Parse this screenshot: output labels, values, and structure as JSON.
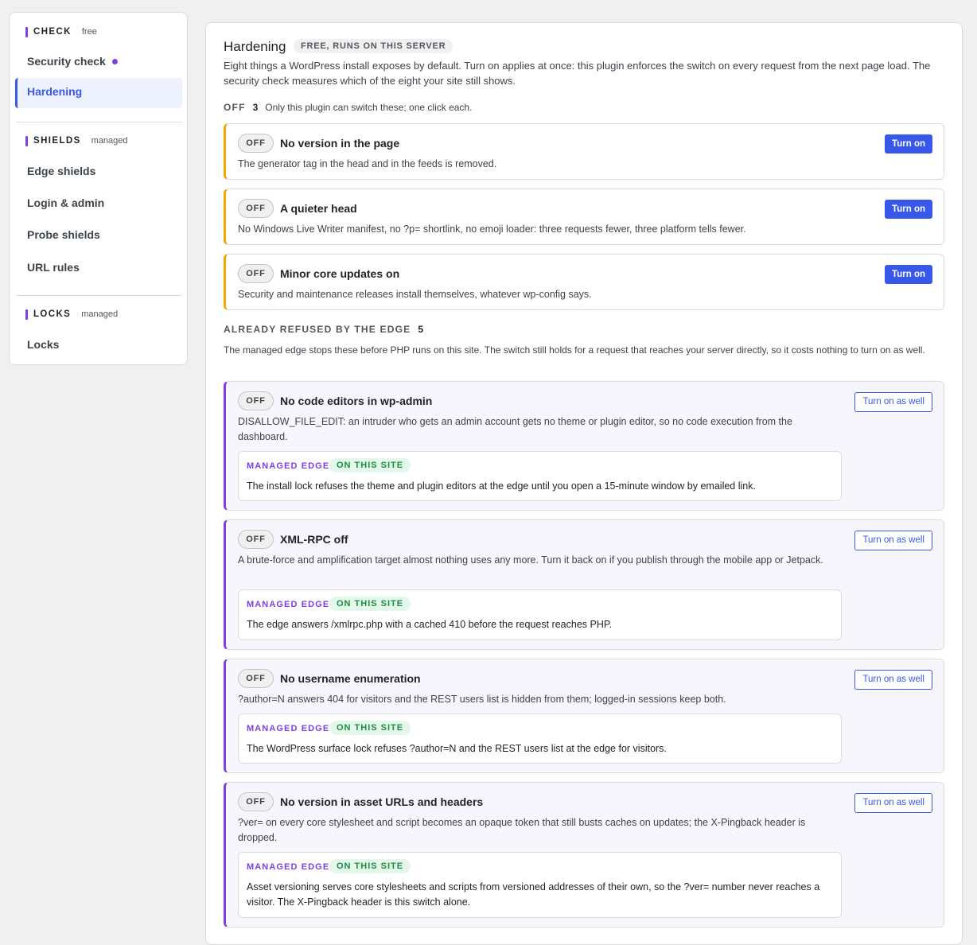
{
  "sidebar": {
    "check": {
      "title": "CHECK",
      "tag": "free",
      "items": [
        "Security check",
        "Hardening"
      ]
    },
    "shields": {
      "title": "SHIELDS",
      "tag": "managed",
      "items": [
        "Edge shields",
        "Login & admin",
        "Probe shields",
        "URL rules"
      ]
    },
    "locks": {
      "title": "LOCKS",
      "tag": "managed",
      "items": [
        "Locks"
      ]
    }
  },
  "main": {
    "title": "Hardening",
    "badge": "FREE, RUNS ON THIS SERVER",
    "intro": "Eight things a WordPress install exposes by default. Turn on applies at once: this plugin enforces the switch on every request from the next page load. The security check measures which of the eight your site still shows.",
    "off_section": {
      "label": "OFF",
      "count": "3",
      "note": "Only this plugin can switch these; one click each."
    },
    "edge_section": {
      "label": "ALREADY REFUSED BY THE EDGE",
      "count": "5",
      "desc": "The managed edge stops these before PHP runs on this site. The switch still holds for a request that reaches your server directly, so it costs nothing to turn on as well."
    },
    "off_label": "OFF",
    "turn_on": "Turn on",
    "turn_on_well": "Turn on as well",
    "managed_edge": "MANAGED EDGE",
    "on_this_site": "ON THIS SITE",
    "off_cards": [
      {
        "title": "No version in the page",
        "desc": "The generator tag in the head and in the feeds is removed."
      },
      {
        "title": "A quieter head",
        "desc": "No Windows Live Writer manifest, no ?p= shortlink, no emoji loader: three requests fewer, three platform tells fewer."
      },
      {
        "title": "Minor core updates on",
        "desc": "Security and maintenance releases install themselves, whatever wp-config says."
      }
    ],
    "edge_cards": [
      {
        "title": "No code editors in wp-admin",
        "desc": "DISALLOW_FILE_EDIT: an intruder who gets an admin account gets no theme or plugin editor, so no code execution from the dashboard.",
        "edge_text": "The install lock refuses the theme and plugin editors at the edge until you open a 15-minute window by emailed link."
      },
      {
        "title": "XML-RPC off",
        "desc": "A brute-force and amplification target almost nothing uses any more. Turn it back on if you publish through the mobile app or Jetpack.",
        "edge_text": "The edge answers /xmlrpc.php with a cached 410 before the request reaches PHP."
      },
      {
        "title": "No username enumeration",
        "desc": "?author=N answers 404 for visitors and the REST users list is hidden from them; logged-in sessions keep both.",
        "edge_text": "The WordPress surface lock refuses ?author=N and the REST users list at the edge for visitors."
      },
      {
        "title": "No version in asset URLs and headers",
        "desc": "?ver= on every core stylesheet and script becomes an opaque token that still busts caches on updates; the X-Pingback header is dropped.",
        "edge_text": "Asset versioning serves core stylesheets and scripts from versioned addresses of their own, so the ?ver= number never reaches a visitor. The X-Pingback header is this switch alone."
      }
    ]
  },
  "colors": {
    "accent": "#3858e9",
    "purple": "#7b3fe4",
    "orange": "#f0a500",
    "green": "#1a8f3f"
  }
}
